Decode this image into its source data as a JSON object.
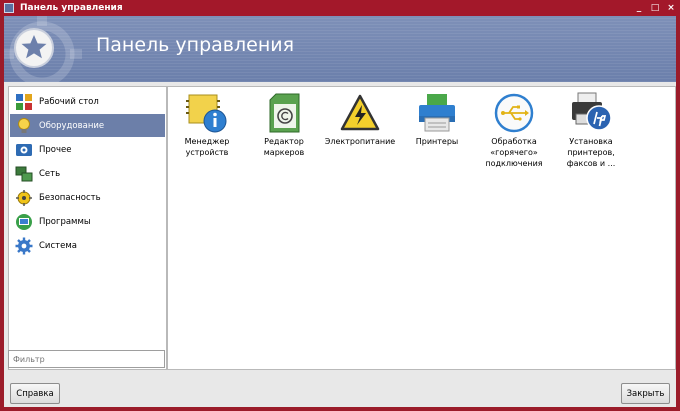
{
  "window": {
    "title": "Панель управления",
    "controls": [
      "_",
      "□",
      "×"
    ]
  },
  "banner": {
    "title": "Панель управления"
  },
  "sidebar": {
    "items": [
      {
        "label": "Рабочий стол",
        "icon": "desktop-icon",
        "active": false
      },
      {
        "label": "Оборудование",
        "icon": "lightbulb-icon",
        "active": true
      },
      {
        "label": "Прочее",
        "icon": "other-icon",
        "active": false
      },
      {
        "label": "Сеть",
        "icon": "network-icon",
        "active": false
      },
      {
        "label": "Безопасность",
        "icon": "security-icon",
        "active": false
      },
      {
        "label": "Программы",
        "icon": "programs-icon",
        "active": false
      },
      {
        "label": "Система",
        "icon": "system-gear-icon",
        "active": false
      }
    ]
  },
  "filter": {
    "placeholder": "Фильтр",
    "value": ""
  },
  "content": {
    "items": [
      {
        "lines": [
          "Менеджер",
          "устройств"
        ],
        "icon": "device-manager-icon"
      },
      {
        "lines": [
          "Редактор",
          "маркеров"
        ],
        "icon": "marker-editor-icon"
      },
      {
        "lines": [
          "Электропитание"
        ],
        "icon": "power-warning-icon"
      },
      {
        "lines": [
          "Принтеры"
        ],
        "icon": "printer-icon"
      },
      {
        "lines": [
          "Обработка",
          "«горячего»",
          "подключения"
        ],
        "icon": "usb-hotplug-icon"
      },
      {
        "lines": [
          "Установка",
          "принтеров,",
          "факсов и ..."
        ],
        "icon": "hp-printer-setup-icon"
      }
    ]
  },
  "buttons": {
    "help": "Справка",
    "close": "Закрыть"
  },
  "colors": {
    "titlebar": "#a3182a",
    "banner": "#7185b0",
    "selection": "#6c7fa9"
  }
}
